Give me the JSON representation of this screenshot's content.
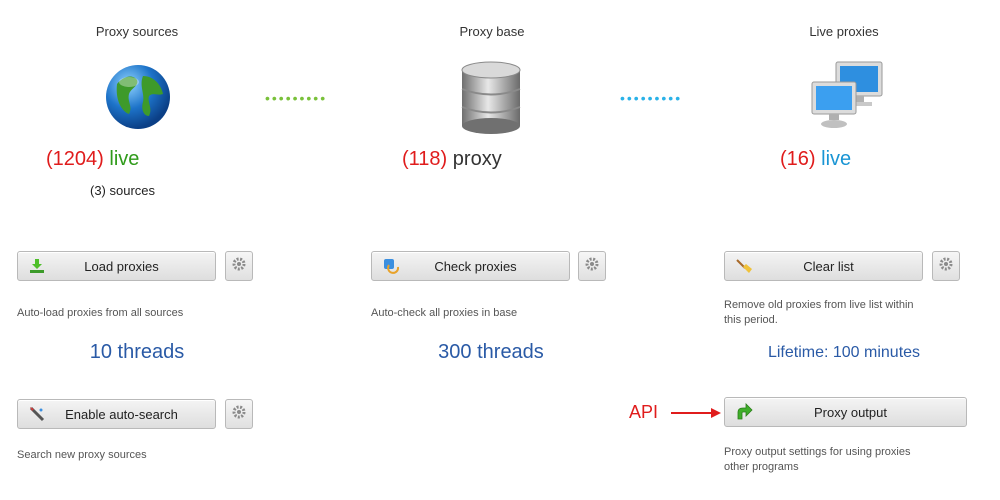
{
  "columns": {
    "sources": {
      "title": "Proxy sources",
      "count": "(1204)",
      "count_word": "live",
      "sub_count": "(3)",
      "sub_word": "sources",
      "button1": {
        "label": "Load proxies",
        "icon": "download-arrow-icon"
      },
      "desc1": "Auto-load proxies from all sources",
      "threads": "10 threads",
      "button2": {
        "label": "Enable auto-search",
        "icon": "search-wand-icon"
      },
      "desc2": "Search new proxy sources"
    },
    "base": {
      "title": "Proxy base",
      "count": "(118)",
      "count_word": "proxy",
      "button1": {
        "label": "Check proxies",
        "icon": "check-refresh-icon"
      },
      "desc1": "Auto-check all proxies in base",
      "threads": "300 threads"
    },
    "live": {
      "title": "Live proxies",
      "count": "(16)",
      "count_word": "live",
      "button1": {
        "label": "Clear list",
        "icon": "broom-icon"
      },
      "desc1_line1": "Remove old proxies from live list within",
      "desc1_line2": "this period.",
      "lifetime": "Lifetime: 100 minutes",
      "api_label": "API",
      "button2": {
        "label": "Proxy output",
        "icon": "green-arrow-icon"
      },
      "desc2_line1": "Proxy output settings for using proxies",
      "desc2_line2": "other programs"
    }
  },
  "connectors": {
    "left": "•••••••••",
    "right": "•••••••••"
  },
  "colors": {
    "count_red": "#e01c1c",
    "live_green": "#2f9b1a",
    "live_blue": "#1a95d4",
    "threads_blue": "#2a5aa6"
  }
}
